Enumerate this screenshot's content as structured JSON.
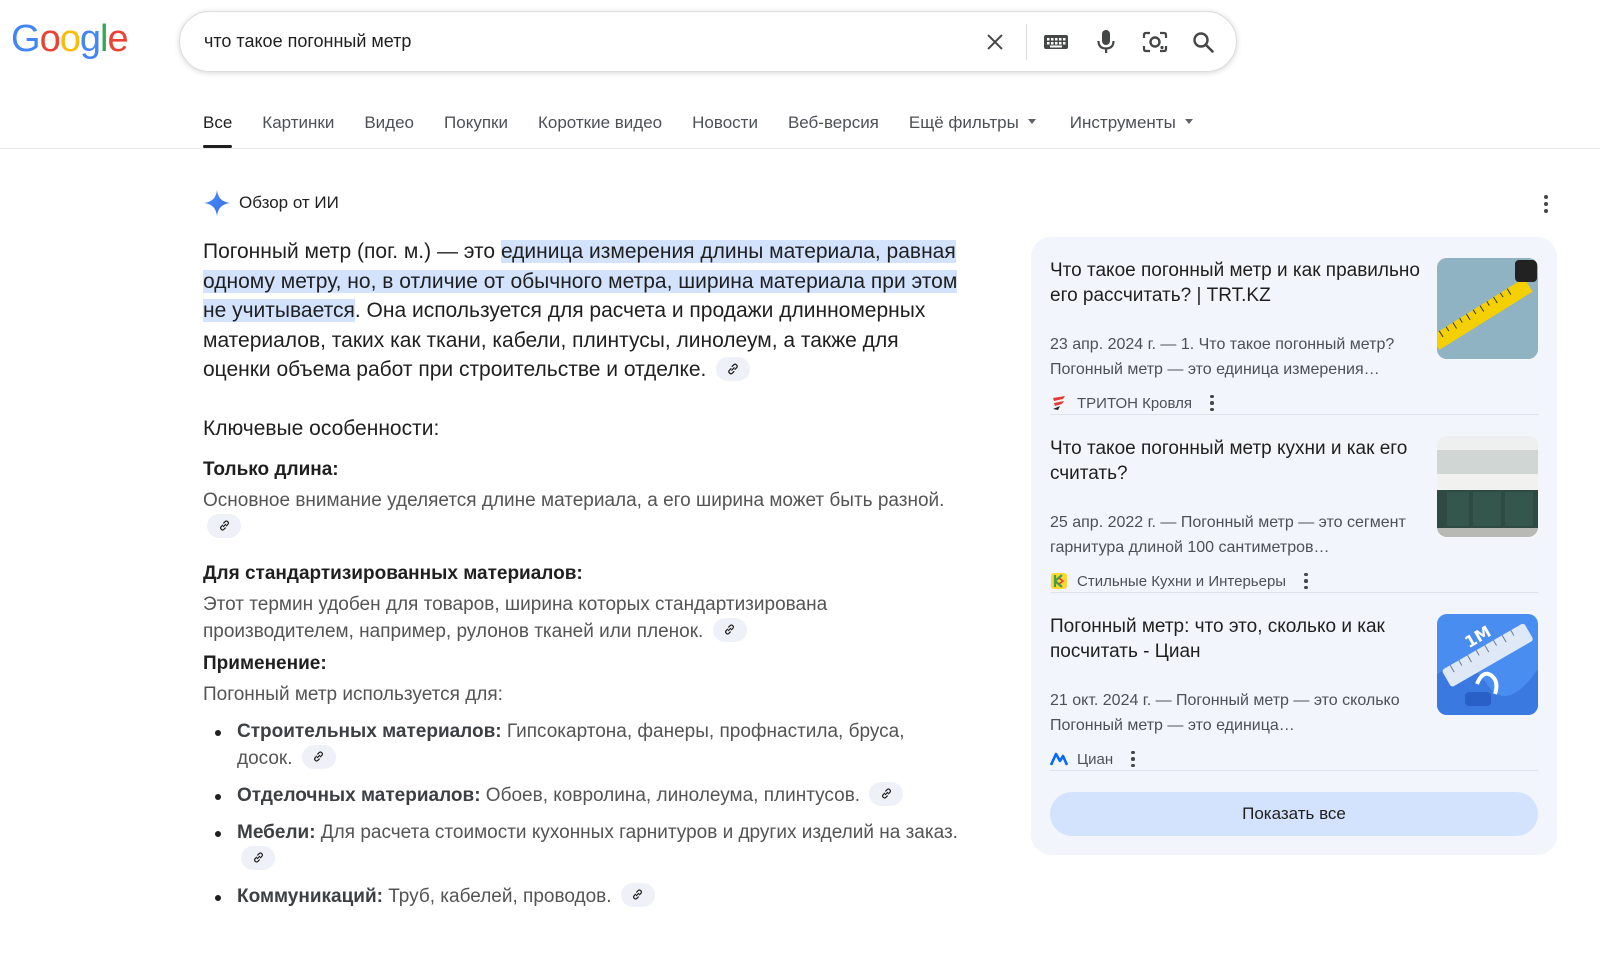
{
  "logo": {
    "letters": [
      "G",
      "o",
      "o",
      "g",
      "l",
      "e"
    ],
    "colors": [
      "#4285F4",
      "#EA4335",
      "#FBBC05",
      "#4285F4",
      "#34A853",
      "#EA4335"
    ]
  },
  "search": {
    "query": "что такое погонный метр"
  },
  "tabs": [
    {
      "label": "Все",
      "active": true
    },
    {
      "label": "Картинки"
    },
    {
      "label": "Видео"
    },
    {
      "label": "Покупки"
    },
    {
      "label": "Короткие видео"
    },
    {
      "label": "Новости"
    },
    {
      "label": "Веб-версия"
    },
    {
      "label": "Ещё фильтры"
    },
    {
      "label": "Инструменты"
    }
  ],
  "ai": {
    "title": "Обзор от ИИ",
    "lead_pre": "Погонный метр (пог. м.) — это ",
    "lead_highlight": "единица измерения длины материала, равная одному метру, но, в отличие от обычного метра, ширина материала при этом не учитывается",
    "lead_post": ". Она используется для расчета и продажи длинномерных материалов, таких как ткани, кабели, плинтусы, линолеум, а также для оценки объема работ при строительстве и отделке.",
    "key_heading": "Ключевые особенности:",
    "features": [
      {
        "title": "Только длина:",
        "text": "Основное внимание уделяется длине материала, а его ширина может быть разной."
      },
      {
        "title": "Для стандартизированных материалов:",
        "text": "Этот термин удобен для товаров, ширина которых стандартизирована производителем, например, рулонов тканей или пленок."
      }
    ],
    "application_title": "Применение:",
    "application_intro": "Погонный метр используется для:",
    "applications": [
      {
        "bold": "Строительных материалов:",
        "text": " Гипсокартона, фанеры, профнастила, бруса, досок."
      },
      {
        "bold": "Отделочных материалов:",
        "text": " Обоев, ковролина, линолеума, плинтусов."
      },
      {
        "bold": "Мебели:",
        "text": " Для расчета стоимости кухонных гарнитуров и других изделий на заказ."
      },
      {
        "bold": "Коммуникаций:",
        "text": " Труб, кабелей, проводов."
      }
    ]
  },
  "sources": [
    {
      "title": "Что такое погонный метр и как правильно его рассчитать? | TRT.KZ",
      "snippet": "23 апр. 2024 г. — 1. Что такое погонный метр? Погонный метр — это единица измерения…",
      "site": "ТРИТОН Кровля"
    },
    {
      "title": "Что такое погонный метр кухни и как его считать?",
      "snippet": "25 апр. 2022 г. — Погонный метр — это сегмент гарнитура длиной 100 сантиметров…",
      "site": "Стильные Кухни и Интерьеры"
    },
    {
      "title": "Погонный метр: что это, сколько и как посчитать - Циан",
      "snippet": "21 окт. 2024 г. — Погонный метр — это сколько Погонный метр — это единица…",
      "site": "Циан"
    }
  ],
  "thumb3_text": "1M",
  "show_all": "Показать все"
}
